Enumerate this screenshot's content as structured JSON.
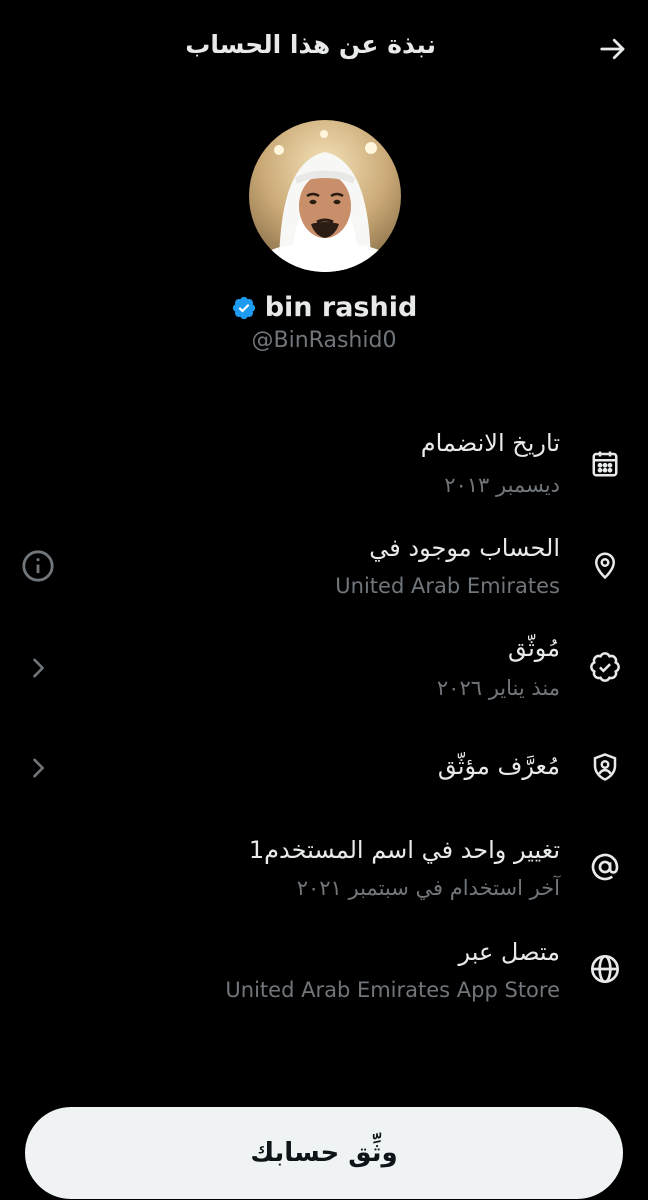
{
  "header": {
    "title": "نبذة عن هذا الحساب",
    "back_icon": "arrow-right-icon"
  },
  "profile": {
    "display_name": "bin rashid",
    "handle": "@BinRashid0",
    "verified": true,
    "badge_color": "#1d9bf0"
  },
  "rows": [
    {
      "icon": "calendar-icon",
      "title": "تاريخ الانضمام",
      "subtitle": "ديسمبر ٢٠١٣"
    },
    {
      "icon": "location-pin-icon",
      "title": "الحساب موجود في",
      "subtitle": "United Arab Emirates",
      "left_action": "info-icon"
    },
    {
      "icon": "verified-check-icon",
      "title": "مُوثّق",
      "subtitle": "منذ يناير ٢٠٢٦",
      "left_action": "chevron-left-icon"
    },
    {
      "icon": "shield-user-icon",
      "title": "مُعرَّف مؤثّق",
      "left_action": "chevron-left-icon"
    },
    {
      "icon": "at-sign-icon",
      "title": "تغيير واحد في اسم المستخدم1",
      "subtitle": "آخر استخدام في سبتمبر ٢٠٢١"
    },
    {
      "icon": "globe-icon",
      "title": "متصل عبر",
      "subtitle": "United Arab Emirates App Store"
    }
  ],
  "footer": {
    "verify_button_label": "وثِّق حسابك"
  },
  "colors": {
    "background": "#000000",
    "primary_text": "#e7e9ea",
    "secondary_text": "#71767b",
    "button_bg": "#eff3f4"
  }
}
